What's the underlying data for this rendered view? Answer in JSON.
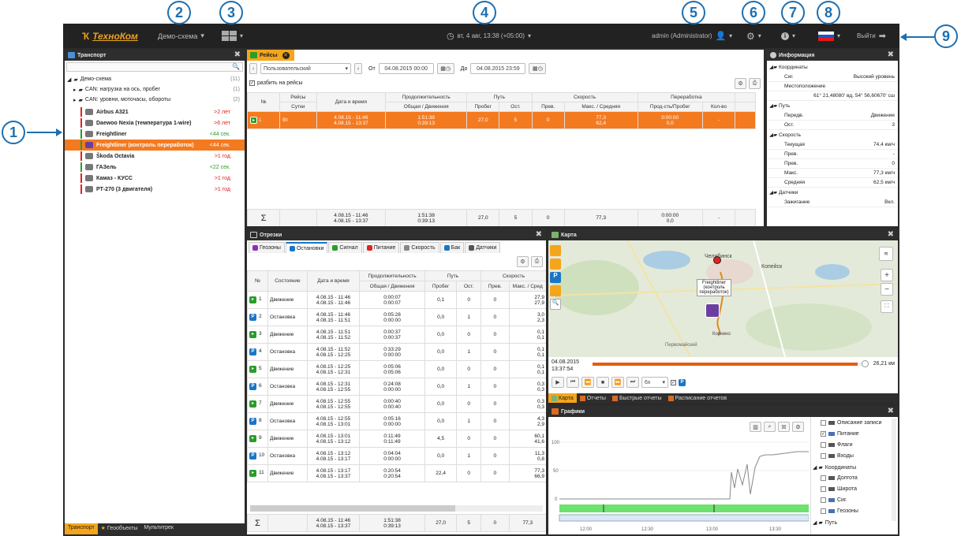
{
  "callouts": [
    "1",
    "2",
    "3",
    "4",
    "5",
    "6",
    "7",
    "8",
    "9"
  ],
  "topbar": {
    "logo": "ТехноКом",
    "scheme": "Демо-схема",
    "clock": "вт, 4 авг, 13:38 (+05:00)",
    "user": "admin (Administrator)",
    "logout": "Выйти"
  },
  "transport": {
    "title": "Транспорт",
    "root": "Демо-схема",
    "root_count": "(11)",
    "groups": [
      {
        "label": "CAN: нагрузка на ось, пробег",
        "count": "(1)"
      },
      {
        "label": "CAN: уровни, моточасы, обороты",
        "count": "(2)"
      }
    ],
    "units": [
      {
        "name": "Airbus A321",
        "age": ">2 лет",
        "color": "#e02222"
      },
      {
        "name": "Daewoo Nexia (температура 1-wire)",
        "age": ">6 лет",
        "color": "#e02222"
      },
      {
        "name": "Freightliner",
        "age": "<44 сек.",
        "color": "#2a9d2a"
      },
      {
        "name": "Freightliner (контроль переработок)",
        "age": "<44 сек.",
        "color": "#2a9d2a"
      },
      {
        "name": "Škoda Octavia",
        "age": ">1 год",
        "color": "#e02222"
      },
      {
        "name": "ГАЗель",
        "age": "<22 сек.",
        "color": "#2a9d2a"
      },
      {
        "name": "Камаз - КУСС",
        "age": ">1 год",
        "color": "#e02222"
      },
      {
        "name": "РТ-270 (3 двигателя)",
        "age": ">1 год",
        "color": "#e02222"
      }
    ],
    "bottom_tabs": [
      "Транспорт",
      "Геообъекты",
      "Мультитрек"
    ]
  },
  "trips": {
    "title": "Рейсы",
    "template": "Пользовательский",
    "from_label": "От",
    "from": "04.08.2015 00:00",
    "to_label": "До",
    "to": "04.08.2015 23:59",
    "split": "разбить на рейсы",
    "h1": [
      "№",
      "Рейсы",
      "Дата и время",
      "Продолжительность",
      "Путь",
      "Скорость",
      "Переработка"
    ],
    "h2": [
      "Сутки",
      "Общая / Движения",
      "Пробег",
      "Ост.",
      "Прев.",
      "Макс. / Средняя",
      "Прод-сть/Пробег",
      "Кол-во"
    ],
    "row": {
      "n": "1",
      "day": "Вт",
      "dt1": "4.08.15 - 11:46",
      "dt2": "4.08.15 - 13:37",
      "d1": "1:51:38",
      "d2": "0:39:13",
      "km": "27,0",
      "stops": "5",
      "over": "0",
      "s1": "77,3",
      "s2": "62,4",
      "o1": "0:00:00",
      "o2": "0,0",
      "cnt": "-"
    },
    "total": {
      "dt1": "4.08.15 - 11:46",
      "dt2": "4.08.15 - 13:37",
      "d1": "1:51:38",
      "d2": "0:39:13",
      "km": "27,0",
      "stops": "5",
      "over": "0",
      "s1": "77,3",
      "o1": "0:00:00",
      "o2": "0,0",
      "cnt": "-"
    }
  },
  "info": {
    "title": "Информация",
    "sections": [
      {
        "title": "Координаты",
        "rows": [
          [
            "Сиг.",
            "Высокий уровень"
          ],
          [
            "Местоположение",
            ""
          ],
          [
            "",
            "61° 21,48080' вд, 54° 56,60670' сш"
          ]
        ]
      },
      {
        "title": "Путь",
        "rows": [
          [
            "Передв.",
            "Движение"
          ],
          [
            "Ост.",
            "3"
          ]
        ]
      },
      {
        "title": "Скорость",
        "rows": [
          [
            "Текущая",
            "74,4 км/ч"
          ],
          [
            "Прев.",
            "-"
          ],
          [
            "Прев.",
            "0"
          ],
          [
            "Макс.",
            "77,3 км/ч"
          ],
          [
            "Средняя",
            "62,5 км/ч"
          ]
        ]
      },
      {
        "title": "Датчики",
        "rows": [
          [
            "Зажигание",
            "Вкл."
          ]
        ]
      }
    ]
  },
  "segments": {
    "title": "Отрезки",
    "tabs": [
      "Геозоны",
      "Остановки",
      "Сигнал",
      "Питание",
      "Скорость",
      "Бак",
      "Датчики"
    ],
    "h1": [
      "№",
      "Состояние",
      "Дата и время",
      "Продолжительность",
      "Путь",
      "Скорость"
    ],
    "h2": [
      "Общая / Движения",
      "Пробег",
      "Ост.",
      "Прев.",
      "Макс. / Сред"
    ],
    "rows": [
      {
        "n": "1",
        "state": "Движение",
        "t1": "4.08.15 - 11:46",
        "t2": "4.08.15 - 11:46",
        "d1": "0:00:07",
        "d2": "0:00:07",
        "km": "0,1",
        "st": "0",
        "pr": "0",
        "s1": "27,9",
        "s2": "27,9",
        "type": "g"
      },
      {
        "n": "2",
        "state": "Остановка",
        "t1": "4.08.15 - 11:46",
        "t2": "4.08.15 - 11:51",
        "d1": "0:05:28",
        "d2": "0:00:00",
        "km": "0,0",
        "st": "1",
        "pr": "0",
        "s1": "3,0",
        "s2": "2,3",
        "type": "p"
      },
      {
        "n": "3",
        "state": "Движение",
        "t1": "4.08.15 - 11:51",
        "t2": "4.08.15 - 11:52",
        "d1": "0:00:37",
        "d2": "0:00:37",
        "km": "0,0",
        "st": "0",
        "pr": "0",
        "s1": "0,1",
        "s2": "0,1",
        "type": "g"
      },
      {
        "n": "4",
        "state": "Остановка",
        "t1": "4.08.15 - 11:52",
        "t2": "4.08.15 - 12:25",
        "d1": "0:33:29",
        "d2": "0:00:00",
        "km": "0,0",
        "st": "1",
        "pr": "0",
        "s1": "0,1",
        "s2": "0,1",
        "type": "p"
      },
      {
        "n": "5",
        "state": "Движение",
        "t1": "4.08.15 - 12:25",
        "t2": "4.08.15 - 12:31",
        "d1": "0:05:06",
        "d2": "0:05:06",
        "km": "0,0",
        "st": "0",
        "pr": "0",
        "s1": "0,1",
        "s2": "0,1",
        "type": "g"
      },
      {
        "n": "6",
        "state": "Остановка",
        "t1": "4.08.15 - 12:31",
        "t2": "4.08.15 - 12:55",
        "d1": "0:24:08",
        "d2": "0:00:00",
        "km": "0,0",
        "st": "1",
        "pr": "0",
        "s1": "0,3",
        "s2": "0,3",
        "type": "p"
      },
      {
        "n": "7",
        "state": "Движение",
        "t1": "4.08.15 - 12:55",
        "t2": "4.08.15 - 12:55",
        "d1": "0:00:40",
        "d2": "0:00:40",
        "km": "0,0",
        "st": "0",
        "pr": "0",
        "s1": "0,3",
        "s2": "0,3",
        "type": "g"
      },
      {
        "n": "8",
        "state": "Остановка",
        "t1": "4.08.15 - 12:55",
        "t2": "4.08.15 - 13:01",
        "d1": "0:05:16",
        "d2": "0:00:00",
        "km": "0,0",
        "st": "1",
        "pr": "0",
        "s1": "4,3",
        "s2": "2,9",
        "type": "p"
      },
      {
        "n": "9",
        "state": "Движение",
        "t1": "4.08.15 - 13:01",
        "t2": "4.08.15 - 13:12",
        "d1": "0:11:49",
        "d2": "0:11:49",
        "km": "4,5",
        "st": "0",
        "pr": "0",
        "s1": "60,1",
        "s2": "41,6",
        "type": "g"
      },
      {
        "n": "10",
        "state": "Остановка",
        "t1": "4.08.15 - 13:12",
        "t2": "4.08.15 - 13:17",
        "d1": "0:04:04",
        "d2": "0:00:00",
        "km": "0,0",
        "st": "1",
        "pr": "0",
        "s1": "11,3",
        "s2": "0,8",
        "type": "p"
      },
      {
        "n": "11",
        "state": "Движение",
        "t1": "4.08.15 - 13:17",
        "t2": "4.08.15 - 13:37",
        "d1": "0:20:54",
        "d2": "0:20:54",
        "km": "22,4",
        "st": "0",
        "pr": "0",
        "s1": "77,3",
        "s2": "66,9",
        "type": "g"
      }
    ],
    "total": {
      "t1": "4.08.15 - 11:46",
      "t2": "4.08.15 - 13:37",
      "d1": "1:51:38",
      "d2": "0:39:13",
      "km": "27,0",
      "st": "5",
      "pr": "0",
      "s1": "77,3"
    }
  },
  "map": {
    "title": "Карта",
    "city1": "Челябинск",
    "city2": "Копейск",
    "city3": "Коркино",
    "city4": "Первомайский",
    "popup": "Freightliner (контроль переработок)",
    "date": "04.08.2015",
    "time": "13:37:54",
    "distance": "26,21 км",
    "speed": "6x",
    "tabs": [
      "Карта",
      "Отчеты",
      "Быстрые отчеты",
      "Расписание отчетов"
    ]
  },
  "charts": {
    "title": "Графики",
    "y": [
      "100",
      "50",
      "0"
    ],
    "x": [
      "12:00",
      "12:30",
      "13:00",
      "13:30"
    ],
    "legend": [
      "Описание записи",
      "Питание",
      "Флаги",
      "Входы",
      "Координаты",
      "Долгота",
      "Широта",
      "Сиг.",
      "Геозоны",
      "Путь"
    ]
  }
}
